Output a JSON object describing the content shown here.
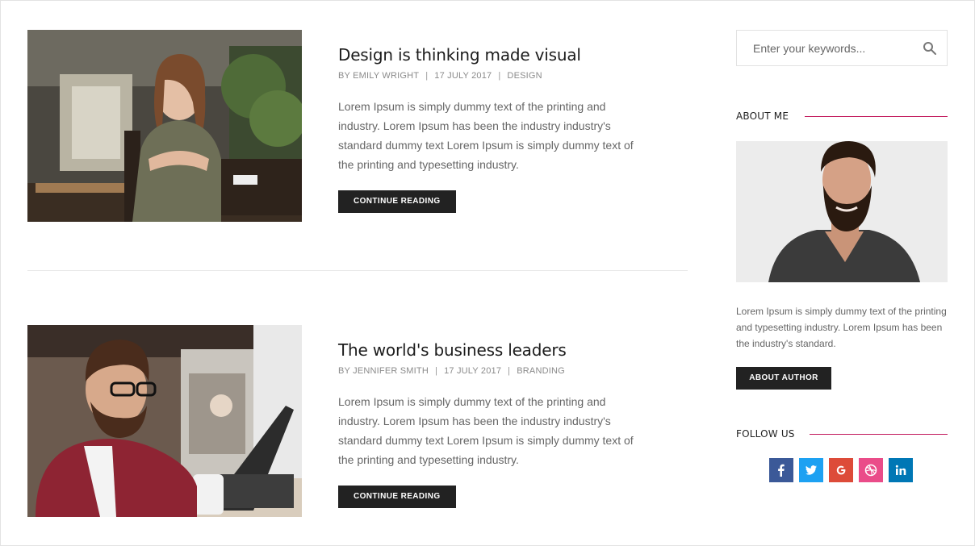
{
  "posts": [
    {
      "title": "Design is thinking made visual",
      "author": "BY EMILY WRIGHT",
      "date": "17 JULY 2017",
      "category": "DESIGN",
      "excerpt": "Lorem Ipsum is simply dummy text of the printing and industry. Lorem Ipsum has been the industry industry's standard dummy text Lorem Ipsum is simply dummy text of the printing and typesetting industry.",
      "button_label": "CONTINUE READING"
    },
    {
      "title": "The world's business leaders",
      "author": "BY JENNIFER SMITH",
      "date": "17 JULY 2017",
      "category": "BRANDING",
      "excerpt": "Lorem Ipsum is simply dummy text of the printing and industry. Lorem Ipsum has been the industry industry's standard dummy text Lorem Ipsum is simply dummy text of the printing and typesetting industry.",
      "button_label": "CONTINUE READING"
    }
  ],
  "meta_separator": "|",
  "sidebar": {
    "search_placeholder": "Enter your keywords...",
    "search_icon": "search-icon",
    "about": {
      "heading": "ABOUT ME",
      "text": "Lorem Ipsum is simply dummy text of the printing and typesetting industry. Lorem Ipsum has been the industry's standard.",
      "button_label": "ABOUT AUTHOR"
    },
    "follow": {
      "heading": "FOLLOW US",
      "networks": [
        {
          "name": "facebook-icon",
          "color": "#3b5998"
        },
        {
          "name": "twitter-icon",
          "color": "#1da1f2"
        },
        {
          "name": "google-plus-icon",
          "color": "#dd4b39"
        },
        {
          "name": "dribbble-icon",
          "color": "#ea4c89"
        },
        {
          "name": "linkedin-icon",
          "color": "#0077b5"
        }
      ]
    }
  },
  "colors": {
    "accent_line": "#c2185b",
    "button_bg": "#222222",
    "text_muted": "#666666"
  }
}
